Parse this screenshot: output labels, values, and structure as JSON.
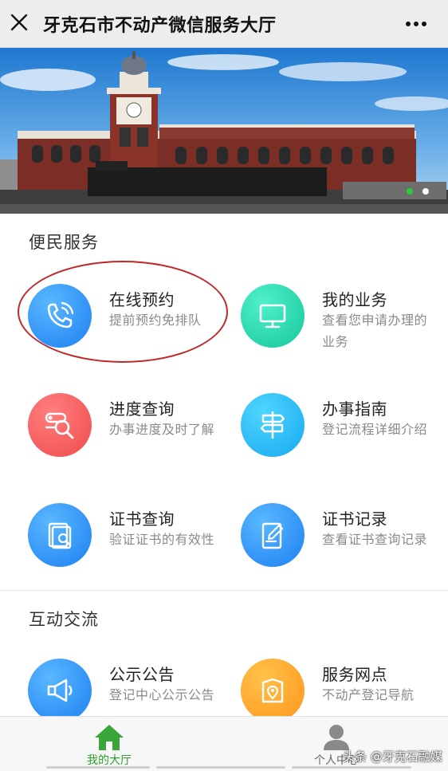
{
  "header": {
    "title": "牙克石市不动产微信服务大厅",
    "close_icon": "close-icon",
    "more_icon": "more-dots-icon"
  },
  "banner": {
    "image": "railway-station-building-photo",
    "slide_count": 2,
    "active_slide": 1,
    "colors": {
      "active_dot": "#2ecc40",
      "inactive_dot": "#ffffff"
    }
  },
  "sections": {
    "convenience": {
      "title": "便民服务",
      "items": [
        {
          "name": "在线预约",
          "desc": "提前预约免排队",
          "icon": "phone-icon",
          "color": "#1d7ff2"
        },
        {
          "name": "我的业务",
          "desc": "查看您申请办理的业务",
          "icon": "monitor-icon",
          "color": "#17c79c"
        },
        {
          "name": "进度查询",
          "desc": "办事进度及时了解",
          "icon": "search-progress-icon",
          "color": "#f04b4b"
        },
        {
          "name": "办事指南",
          "desc": "登记流程详细介绍",
          "icon": "signpost-icon",
          "color": "#17a9ef"
        },
        {
          "name": "证书查询",
          "desc": "验证证书的有效性",
          "icon": "certificate-search-icon",
          "color": "#1d7ff2"
        },
        {
          "name": "证书记录",
          "desc": "查看证书查询记录",
          "icon": "edit-record-icon",
          "color": "#1d7ff2"
        }
      ]
    },
    "interaction": {
      "title": "互动交流",
      "items": [
        {
          "name": "公示公告",
          "desc": "登记中心公示公告",
          "icon": "megaphone-icon",
          "color": "#1d7ff2"
        },
        {
          "name": "服务网点",
          "desc": "不动产登记导航",
          "icon": "map-location-icon",
          "color": "#ff9419"
        }
      ]
    }
  },
  "tabbar": {
    "tabs": [
      {
        "label": "我的大厅",
        "icon": "home-icon",
        "active": true
      },
      {
        "label": "个人中心",
        "icon": "user-icon",
        "active": false
      }
    ],
    "colors": {
      "active": "#2e9e2e"
    }
  },
  "watermark": "头条 @牙克石融媒"
}
